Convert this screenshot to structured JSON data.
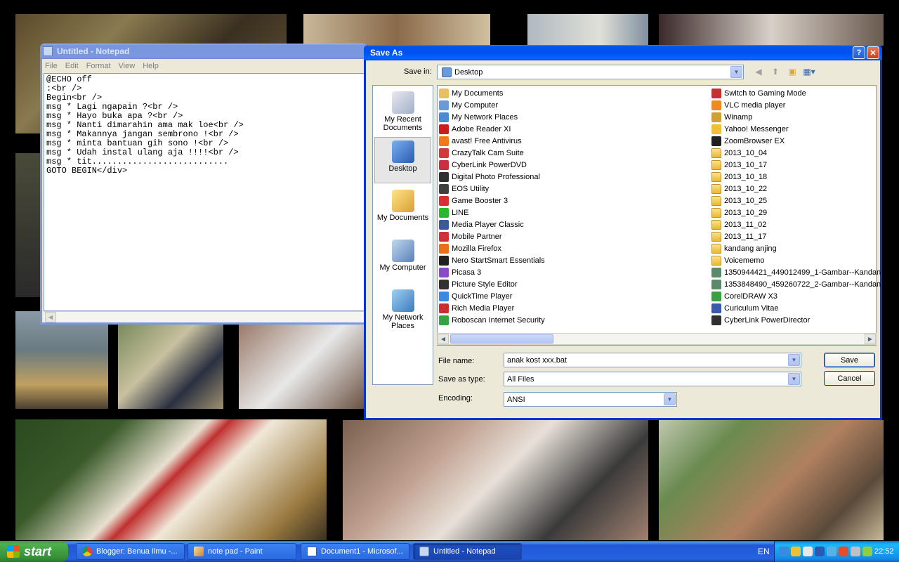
{
  "notepad": {
    "title": "Untitled - Notepad",
    "menu": [
      "File",
      "Edit",
      "Format",
      "View",
      "Help"
    ],
    "content": "@ECHO off\n:<br />\nBegin<br />\nmsg * Lagi ngapain ?<br />\nmsg * Hayo buka apa ?<br />\nmsg * Nanti dimarahin ama mak loe<br />\nmsg * Makannya jangan sembrono !<br />\nmsg * minta bantuan gih sono !<br />\nmsg * Udah instal ulang aja !!!!<br />\nmsg * tit...........................\nGOTO BEGIN</div>"
  },
  "dialog": {
    "title": "Save As",
    "save_in_label": "Save in:",
    "save_in_value": "Desktop",
    "places": [
      "My Recent Documents",
      "Desktop",
      "My Documents",
      "My Computer",
      "My Network Places"
    ],
    "files_left": [
      {
        "name": "My Documents",
        "icon": "documents-icon",
        "color": "#e8c060"
      },
      {
        "name": "My Computer",
        "icon": "computer-icon",
        "color": "#6a9ad8"
      },
      {
        "name": "My Network Places",
        "icon": "network-icon",
        "color": "#4a8ad0"
      },
      {
        "name": "Adobe Reader XI",
        "icon": "adobe-reader-icon",
        "color": "#c81e1e"
      },
      {
        "name": "avast! Free Antivirus",
        "icon": "avast-icon",
        "color": "#f07a1a"
      },
      {
        "name": "CrazyTalk Cam Suite",
        "icon": "crazytalk-icon",
        "color": "#d03a3a"
      },
      {
        "name": "CyberLink PowerDVD",
        "icon": "powerdvd-icon",
        "color": "#c83040"
      },
      {
        "name": "Digital Photo Professional",
        "icon": "dpp-icon",
        "color": "#303030"
      },
      {
        "name": "EOS Utility",
        "icon": "eos-icon",
        "color": "#404040"
      },
      {
        "name": "Game Booster 3",
        "icon": "game-booster-icon",
        "color": "#d83030"
      },
      {
        "name": "LINE",
        "icon": "line-icon",
        "color": "#2cb82c"
      },
      {
        "name": "Media Player Classic",
        "icon": "mpc-icon",
        "color": "#3a5a9a"
      },
      {
        "name": "Mobile Partner",
        "icon": "mobile-partner-icon",
        "color": "#d0303a"
      },
      {
        "name": "Mozilla Firefox",
        "icon": "firefox-icon",
        "color": "#e8701a"
      },
      {
        "name": "Nero StartSmart Essentials",
        "icon": "nero-icon",
        "color": "#202020"
      },
      {
        "name": "Picasa 3",
        "icon": "picasa-icon",
        "color": "#8a4ac8"
      },
      {
        "name": "Picture Style Editor",
        "icon": "picture-style-icon",
        "color": "#303030"
      },
      {
        "name": "QuickTime Player",
        "icon": "quicktime-icon",
        "color": "#3a8ae0"
      },
      {
        "name": "Rich Media Player",
        "icon": "rich-media-icon",
        "color": "#c83030"
      },
      {
        "name": "Roboscan Internet Security",
        "icon": "roboscan-icon",
        "color": "#3aa040"
      }
    ],
    "files_right": [
      {
        "name": "Switch to Gaming Mode",
        "icon": "gaming-mode-icon",
        "color": "#c83030"
      },
      {
        "name": "VLC media player",
        "icon": "vlc-icon",
        "color": "#f08a1a"
      },
      {
        "name": "Winamp",
        "icon": "winamp-icon",
        "color": "#d0a030"
      },
      {
        "name": "Yahoo! Messenger",
        "icon": "yahoo-icon",
        "color": "#f0c030"
      },
      {
        "name": "ZoomBrowser EX",
        "icon": "zoombrowser-icon",
        "color": "#202020"
      },
      {
        "name": "2013_10_04",
        "icon": "folder-icon",
        "color": "folder"
      },
      {
        "name": "2013_10_17",
        "icon": "folder-icon",
        "color": "folder"
      },
      {
        "name": "2013_10_18",
        "icon": "folder-icon",
        "color": "folder"
      },
      {
        "name": "2013_10_22",
        "icon": "folder-icon",
        "color": "folder"
      },
      {
        "name": "2013_10_25",
        "icon": "folder-icon",
        "color": "folder"
      },
      {
        "name": "2013_10_29",
        "icon": "folder-icon",
        "color": "folder"
      },
      {
        "name": "2013_11_02",
        "icon": "folder-icon",
        "color": "folder"
      },
      {
        "name": "2013_11_17",
        "icon": "folder-icon",
        "color": "folder"
      },
      {
        "name": "kandang anjing",
        "icon": "folder-icon",
        "color": "folder"
      },
      {
        "name": "Voicememo",
        "icon": "folder-icon",
        "color": "folder"
      },
      {
        "name": "1350944421_449012499_1-Gambar--Kandan",
        "icon": "image-file-icon",
        "color": "#5a8a6a"
      },
      {
        "name": "1353848490_459260722_2-Gambar--Kandan",
        "icon": "image-file-icon",
        "color": "#5a8a6a"
      },
      {
        "name": "CorelDRAW X3",
        "icon": "coreldraw-icon",
        "color": "#3aa040"
      },
      {
        "name": "Curiculum Vitae",
        "icon": "word-doc-icon",
        "color": "#3a5ab0"
      },
      {
        "name": "CyberLink PowerDirector",
        "icon": "powerdirector-icon",
        "color": "#303030"
      }
    ],
    "file_name_label": "File name:",
    "file_name_value": "anak kost xxx.bat",
    "save_as_type_label": "Save as type:",
    "save_as_type_value": "All Files",
    "encoding_label": "Encoding:",
    "encoding_value": "ANSI",
    "save_button": "Save",
    "cancel_button": "Cancel"
  },
  "taskbar": {
    "start_label": "start",
    "tasks": [
      {
        "label": "Blogger: Benua Ilmu -...",
        "icon": "chrome-icon"
      },
      {
        "label": "note pad - Paint",
        "icon": "paint-icon"
      },
      {
        "label": "Document1 - Microsof...",
        "icon": "word-icon"
      },
      {
        "label": "Untitled - Notepad",
        "icon": "notepad-icon"
      }
    ],
    "language": "EN",
    "clock": "22:52"
  }
}
